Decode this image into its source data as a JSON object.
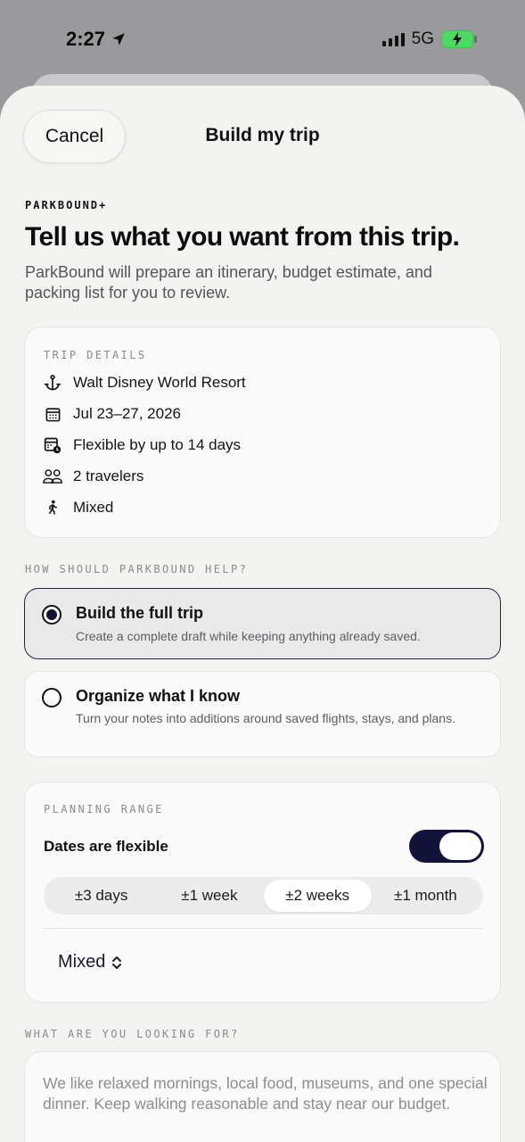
{
  "status_bar": {
    "time": "2:27",
    "network": "5G",
    "icons": [
      "location-arrow-icon",
      "signal-bars-icon",
      "battery-charging-icon"
    ],
    "battery_color": "#4cd964"
  },
  "nav": {
    "cancel_label": "Cancel",
    "title": "Build my trip"
  },
  "intro": {
    "eyebrow": "PARKBOUND+",
    "headline": "Tell us what you want from this trip.",
    "subtext": "ParkBound will prepare an itinerary, budget estimate, and packing list for you to review."
  },
  "trip_details": {
    "label": "TRIP DETAILS",
    "items": [
      {
        "icon": "anchor-icon",
        "text": "Walt Disney World Resort"
      },
      {
        "icon": "calendar-icon",
        "text": "Jul 23–27, 2026"
      },
      {
        "icon": "calendar-clock-icon",
        "text": "Flexible by up to 14 days"
      },
      {
        "icon": "travelers-icon",
        "text": "2 travelers"
      },
      {
        "icon": "walking-person-icon",
        "text": "Mixed"
      }
    ]
  },
  "help": {
    "label": "HOW SHOULD PARKBOUND HELP?",
    "options": [
      {
        "title": "Build the full trip",
        "description": "Create a complete draft while keeping anything already saved.",
        "selected": true
      },
      {
        "title": "Organize what I know",
        "description": "Turn your notes into additions around saved flights, stays, and plans.",
        "selected": false
      }
    ]
  },
  "planning_range": {
    "label": "PLANNING RANGE",
    "flexible_label": "Dates are flexible",
    "flexible_on": true,
    "segments": [
      "±3 days",
      "±1 week",
      "±2 weeks",
      "±1 month"
    ],
    "selected_segment": "±2 weeks",
    "pace_value": "Mixed"
  },
  "looking_for": {
    "label": "WHAT ARE YOU LOOKING FOR?",
    "placeholder": "We like relaxed mornings, local food, museums, and one special dinner. Keep walking reasonable and stay near our budget."
  },
  "colors": {
    "accent": "#12123a",
    "sheet_background": "#f3f3f2",
    "card_background": "#fafafa"
  }
}
